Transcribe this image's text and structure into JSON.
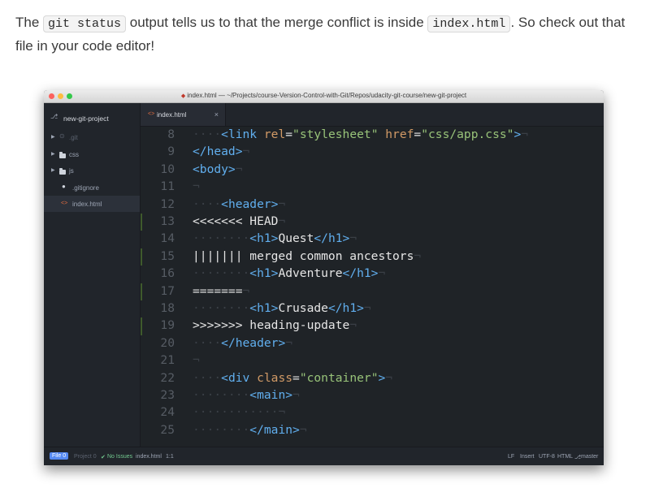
{
  "intro": {
    "part1": "The ",
    "code1": "git status",
    "part2": " output tells us to that the merge conflict is inside ",
    "code2": "index.html",
    "part3": ". So check out that file in your code editor!"
  },
  "window": {
    "title": "index.html — ~/Projects/course-Version-Control-with-Git/Repos/udacity-git-course/new-git-project"
  },
  "sidebar": {
    "project": "new-git-project",
    "items": [
      {
        "label": ".git",
        "icon": "git-icon"
      },
      {
        "label": "css",
        "icon": "folder-icon"
      },
      {
        "label": "js",
        "icon": "folder-icon"
      },
      {
        "label": ".gitignore",
        "icon": "github-icon"
      },
      {
        "label": "index.html",
        "icon": "code-icon"
      }
    ]
  },
  "tab": {
    "label": "index.html",
    "close": "×"
  },
  "editor": {
    "lines": [
      {
        "n": "8",
        "lead": "····",
        "mark": false
      },
      {
        "n": "9",
        "lead": "",
        "mark": false
      },
      {
        "n": "10",
        "lead": "",
        "mark": false
      },
      {
        "n": "11",
        "lead": "",
        "mark": false
      },
      {
        "n": "12",
        "lead": "····",
        "mark": false
      },
      {
        "n": "13",
        "lead": "",
        "mark": true
      },
      {
        "n": "14",
        "lead": "········",
        "mark": false
      },
      {
        "n": "15",
        "lead": "",
        "mark": true
      },
      {
        "n": "16",
        "lead": "········",
        "mark": false
      },
      {
        "n": "17",
        "lead": "",
        "mark": true
      },
      {
        "n": "18",
        "lead": "········",
        "mark": false
      },
      {
        "n": "19",
        "lead": "",
        "mark": true
      },
      {
        "n": "20",
        "lead": "····",
        "mark": false
      },
      {
        "n": "21",
        "lead": "",
        "mark": false
      },
      {
        "n": "22",
        "lead": "····",
        "mark": false
      },
      {
        "n": "23",
        "lead": "········",
        "mark": false
      },
      {
        "n": "24",
        "lead": "············",
        "mark": false
      },
      {
        "n": "25",
        "lead": "········",
        "mark": false
      }
    ],
    "code": {
      "l8": [
        "<link",
        " rel",
        "=",
        "\"stylesheet\"",
        " href",
        "=",
        "\"css/app.css\"",
        ">"
      ],
      "l9": "</head>",
      "l10": "<body>",
      "l12": "<header>",
      "l13": "<<<<<<< HEAD",
      "l14": [
        "<h1>",
        "Quest",
        "</h1>"
      ],
      "l15": "||||||| merged common ancestors",
      "l16": [
        "<h1>",
        "Adventure",
        "</h1>"
      ],
      "l17": "=======",
      "l18": [
        "<h1>",
        "Crusade",
        "</h1>"
      ],
      "l19": ">>>>>>> heading-update",
      "l20": "</header>",
      "l22": [
        "<div",
        " class",
        "=",
        "\"container\"",
        ">"
      ],
      "l23": "<main>",
      "l25": "</main>"
    },
    "eol": "¬"
  },
  "statusbar": {
    "file": "File 0",
    "project": "Project 0",
    "issues": "No Issues",
    "filename": "index.html",
    "cursor": "1:1",
    "line_ending": "LF",
    "mode": "Insert",
    "encoding": "UTF-8",
    "grammar": "HTML",
    "branch": "master"
  },
  "colors": {
    "close": "#fc615d",
    "minimize": "#fdbc40",
    "zoom": "#34c84a",
    "tag": "#61afef",
    "attr": "#d19a66",
    "string": "#98c379"
  }
}
